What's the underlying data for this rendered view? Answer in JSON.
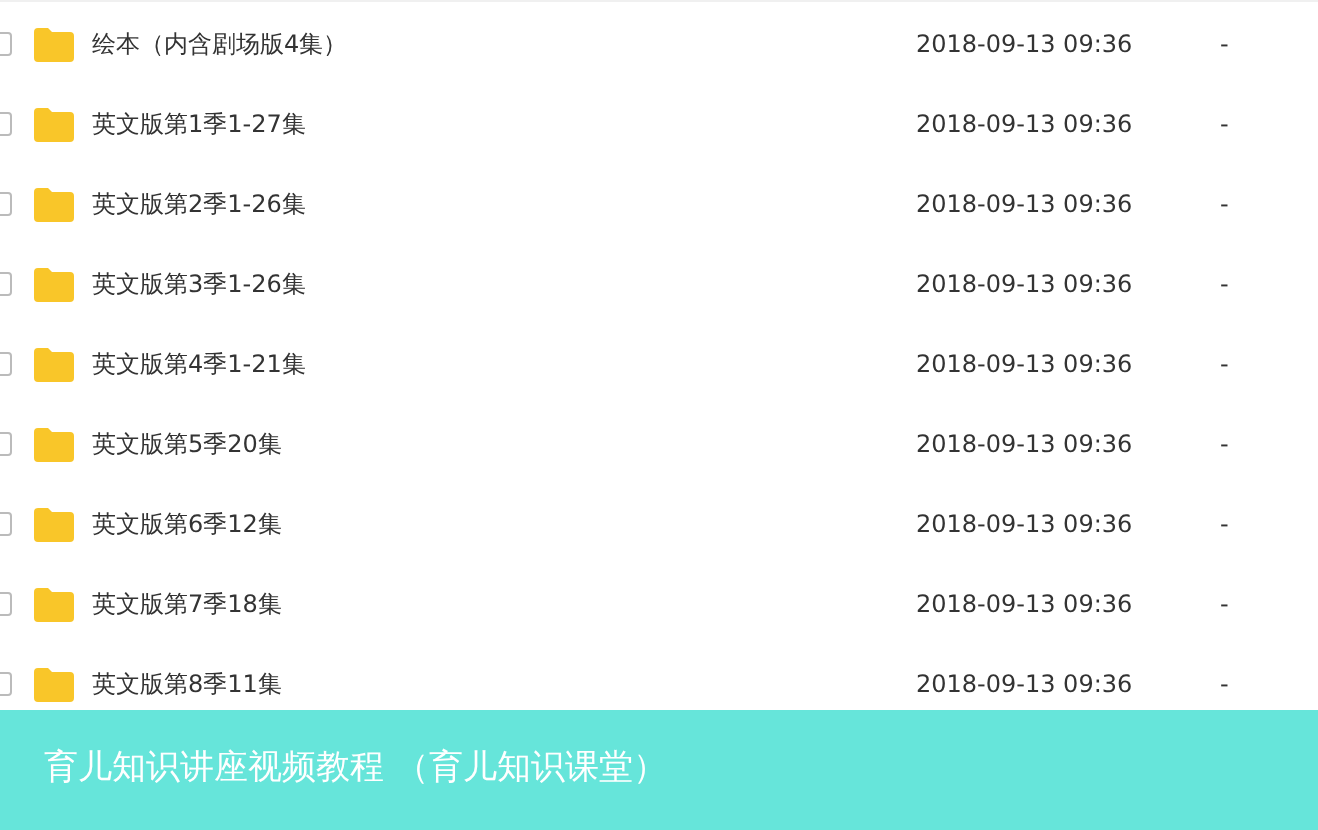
{
  "files": [
    {
      "name": "绘本（内含剧场版4集）",
      "modified": "2018-09-13 09:36",
      "size": "-",
      "checked": false
    },
    {
      "name": "英文版第1季1-27集",
      "modified": "2018-09-13 09:36",
      "size": "-",
      "checked": false
    },
    {
      "name": "英文版第2季1-26集",
      "modified": "2018-09-13 09:36",
      "size": "-",
      "checked": false
    },
    {
      "name": "英文版第3季1-26集",
      "modified": "2018-09-13 09:36",
      "size": "-",
      "checked": false
    },
    {
      "name": "英文版第4季1-21集",
      "modified": "2018-09-13 09:36",
      "size": "-",
      "checked": false
    },
    {
      "name": "英文版第5季20集",
      "modified": "2018-09-13 09:36",
      "size": "-",
      "checked": false
    },
    {
      "name": "英文版第6季12集",
      "modified": "2018-09-13 09:36",
      "size": "-",
      "checked": false
    },
    {
      "name": "英文版第7季18集",
      "modified": "2018-09-13 09:36",
      "size": "-",
      "checked": false
    },
    {
      "name": "英文版第8季11集",
      "modified": "2018-09-13 09:36",
      "size": "-",
      "checked": false
    }
  ],
  "banner": {
    "title": "育儿知识讲座视频教程 （育儿知识课堂）"
  }
}
